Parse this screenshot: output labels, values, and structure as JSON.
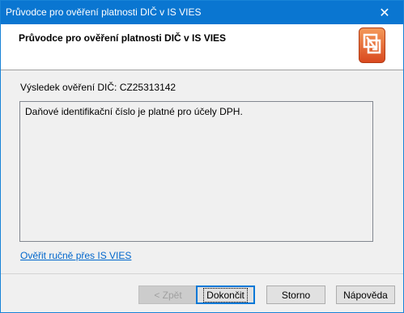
{
  "window": {
    "title": "Průvodce pro ověření platnosti DIČ v IS VIES",
    "close_glyph": "✕"
  },
  "header": {
    "heading": "Průvodce pro ověření platnosti DIČ v IS VIES",
    "logo_icon": "vies-wizard-logo-icon"
  },
  "result": {
    "label": "Výsledek ověření DIČ: CZ25313142",
    "message": "Daňové identifikační číslo je platné pro účely DPH."
  },
  "link": {
    "text": "Ověřit ručně přes IS VIES"
  },
  "buttons": {
    "back": "< Zpět",
    "finish": "Dokončit",
    "cancel": "Storno",
    "help": "Nápověda"
  },
  "colors": {
    "titlebar": "#0a76d1",
    "link": "#0066cc",
    "logo_orange": "#e8612c",
    "default_button_border": "#0078d7"
  }
}
